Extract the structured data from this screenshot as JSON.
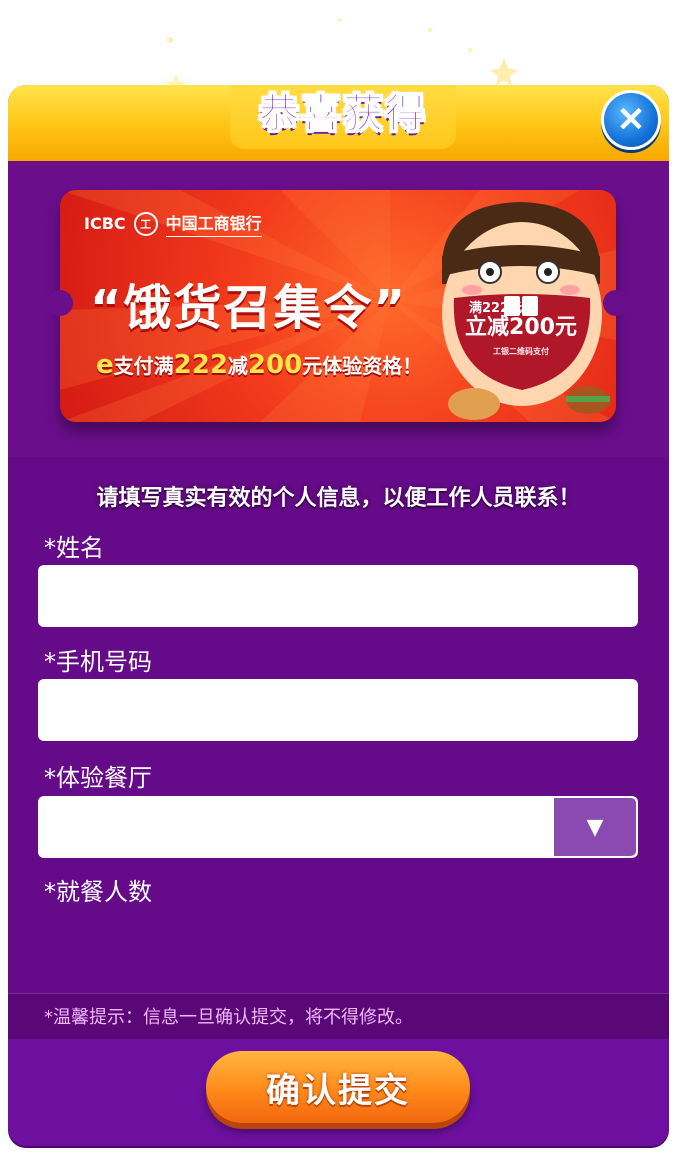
{
  "modal": {
    "title": "恭喜获得",
    "close_icon": "close-icon"
  },
  "coupon": {
    "bank_name_en": "ICBC",
    "bank_logo_glyph": "工",
    "bank_name_cn": "中国工商银行",
    "slogan": "“饿货召集令”",
    "offer_prefix": "e",
    "offer_part1": "支付满",
    "offer_amount1": "222",
    "offer_part2": "减",
    "offer_amount2": "200",
    "offer_part3": "元",
    "offer_suffix": "体验资格！",
    "badge_line1": "满222元",
    "badge_line2": "立减200元",
    "badge_line3": "工银二维码支付"
  },
  "form": {
    "instruction": "请填写真实有效的个人信息，以便工作人员联系！",
    "name_label": "*姓名",
    "name_value": "",
    "phone_label": "*手机号码",
    "phone_value": "",
    "restaurant_label": "*体验餐厅",
    "restaurant_value": "",
    "restaurant_arrow": "▼",
    "diners_label": "*就餐人数"
  },
  "tip": "*温馨提示：信息一旦确认提交，将不得修改。",
  "submit_label": "确认提交",
  "colors": {
    "modal_bg": "#6a0e8c",
    "header_yellow": "#ffc414",
    "title_purple": "#7a23c9",
    "close_blue": "#1473d9",
    "coupon_red": "#f23a1c",
    "submit_orange": "#ff8a1a"
  }
}
